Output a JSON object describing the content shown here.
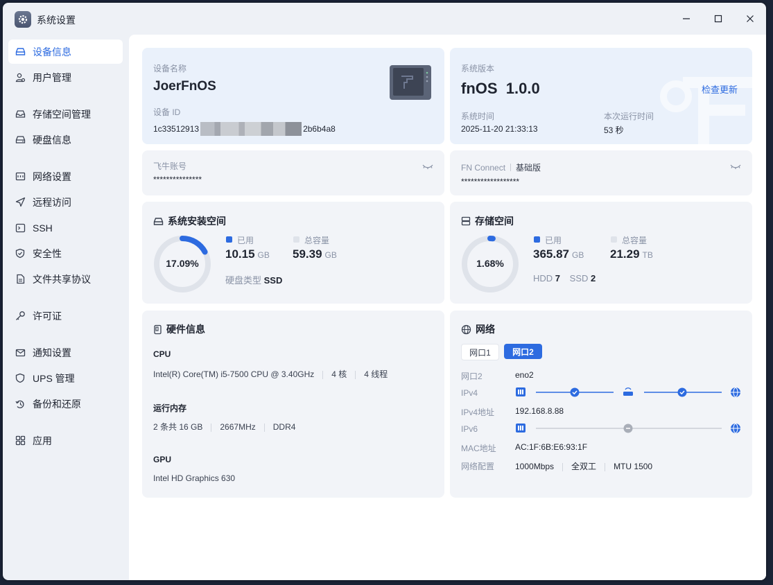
{
  "window": {
    "title": "系统设置"
  },
  "sidebar": {
    "items": [
      {
        "label": "设备信息",
        "icon": "device-info-icon",
        "active": true
      },
      {
        "label": "用户管理",
        "icon": "users-icon"
      },
      {
        "label": "存储空间管理",
        "icon": "storage-icon"
      },
      {
        "label": "硬盘信息",
        "icon": "disk-icon"
      },
      {
        "label": "网络设置",
        "icon": "network-settings-icon"
      },
      {
        "label": "远程访问",
        "icon": "send-icon"
      },
      {
        "label": "SSH",
        "icon": "terminal-icon"
      },
      {
        "label": "安全性",
        "icon": "shield-icon"
      },
      {
        "label": "文件共享协议",
        "icon": "file-icon"
      },
      {
        "label": "许可证",
        "icon": "key-icon"
      },
      {
        "label": "通知设置",
        "icon": "mail-icon"
      },
      {
        "label": "UPS 管理",
        "icon": "ups-shield-icon"
      },
      {
        "label": "备份和还原",
        "icon": "backup-icon"
      },
      {
        "label": "应用",
        "icon": "apps-icon"
      }
    ]
  },
  "device": {
    "name_label": "设备名称",
    "name": "JoerFnOS",
    "id_label": "设备 ID",
    "id_prefix": "1c33512913",
    "id_suffix": "2b6b4a8"
  },
  "system": {
    "version_label": "系统版本",
    "version": "fnOS  1.0.0",
    "check_update": "检查更新",
    "time_label": "系统时间",
    "time": "2025-11-20 21:33:13",
    "uptime_label": "本次运行时间",
    "uptime": "53 秒"
  },
  "feiniu": {
    "label": "飞牛账号",
    "value": "***************"
  },
  "fnconnect": {
    "label": "FN Connect",
    "tier": "基础版",
    "value": "******************"
  },
  "sys_space": {
    "title": "系统安装空间",
    "percent_text": "17.09%",
    "percent": 0.1709,
    "used_label": "已用",
    "used": "10.15",
    "used_unit": "GB",
    "total_label": "总容量",
    "total": "59.39",
    "total_unit": "GB",
    "disk_type_label": "硬盘类型",
    "disk_type": "SSD"
  },
  "storage": {
    "title": "存储空间",
    "percent_text": "1.68%",
    "percent": 0.0168,
    "used_label": "已用",
    "used": "365.87",
    "used_unit": "GB",
    "total_label": "总容量",
    "total": "21.29",
    "total_unit": "TB",
    "hdd_label": "HDD",
    "hdd": "7",
    "ssd_label": "SSD",
    "ssd": "2"
  },
  "hardware": {
    "title": "硬件信息",
    "cpu_label": "CPU",
    "cpu_model": "Intel(R) Core(TM) i5-7500 CPU @ 3.40GHz",
    "cpu_cores": "4 核",
    "cpu_threads": "4 线程",
    "mem_label": "运行内存",
    "mem_count": "2 条共 16 GB",
    "mem_freq": "2667MHz",
    "mem_type": "DDR4",
    "gpu_label": "GPU",
    "gpu_model": "Intel HD Graphics 630"
  },
  "network": {
    "title": "网络",
    "tab1": "网口1",
    "tab2": "网口2",
    "iface_label": "网口2",
    "iface": "eno2",
    "ipv4_label": "IPv4",
    "ipv4_addr_label": "IPv4地址",
    "ipv4_addr": "192.168.8.88",
    "ipv6_label": "IPv6",
    "mac_label": "MAC地址",
    "mac": "AC:1F:6B:E6:93:1F",
    "config_label": "网络配置",
    "speed": "1000Mbps",
    "duplex": "全双工",
    "mtu": "MTU 1500"
  },
  "colors": {
    "accent": "#2d6be0",
    "card": "#f2f4f8",
    "card_blue": "#eaf1fb",
    "ring_bg": "#dfe3ea"
  }
}
